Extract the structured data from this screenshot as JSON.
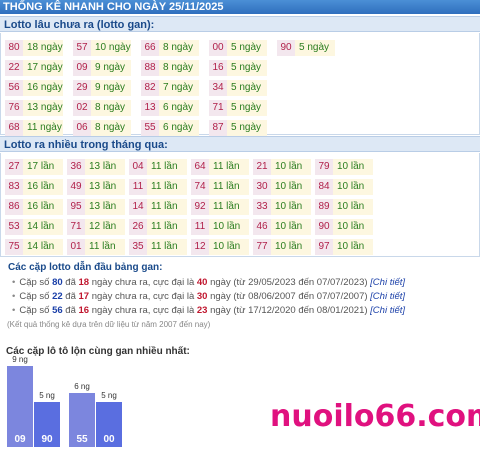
{
  "header": {
    "title": "THỐNG KÊ NHANH CHO NGÀY 25/11/2025"
  },
  "gan": {
    "title": "Lotto lâu chưa ra (lotto gan):",
    "items": [
      {
        "num": "80",
        "val": "18 ngày"
      },
      {
        "num": "57",
        "val": "10 ngày"
      },
      {
        "num": "66",
        "val": "8 ngày"
      },
      {
        "num": "00",
        "val": "5 ngày"
      },
      {
        "num": "90",
        "val": "5 ngày"
      },
      {
        "num": "22",
        "val": "17 ngày"
      },
      {
        "num": "09",
        "val": "9 ngày"
      },
      {
        "num": "88",
        "val": "8 ngày"
      },
      {
        "num": "16",
        "val": "5 ngày"
      },
      {
        "num": "56",
        "val": "16 ngày"
      },
      {
        "num": "29",
        "val": "9 ngày"
      },
      {
        "num": "82",
        "val": "7 ngày"
      },
      {
        "num": "34",
        "val": "5 ngày"
      },
      {
        "num": "76",
        "val": "13 ngày"
      },
      {
        "num": "02",
        "val": "8 ngày"
      },
      {
        "num": "13",
        "val": "6 ngày"
      },
      {
        "num": "71",
        "val": "5 ngày"
      },
      {
        "num": "68",
        "val": "11 ngày"
      },
      {
        "num": "06",
        "val": "8 ngày"
      },
      {
        "num": "55",
        "val": "6 ngày"
      },
      {
        "num": "87",
        "val": "5 ngày"
      }
    ]
  },
  "often": {
    "title": "Lotto ra nhiều trong tháng qua:",
    "items": [
      {
        "num": "27",
        "val": "17 lần"
      },
      {
        "num": "36",
        "val": "13 lần"
      },
      {
        "num": "04",
        "val": "11 lần"
      },
      {
        "num": "64",
        "val": "11 lần"
      },
      {
        "num": "21",
        "val": "10 lần"
      },
      {
        "num": "79",
        "val": "10 lần"
      },
      {
        "num": "83",
        "val": "16 lần"
      },
      {
        "num": "49",
        "val": "13 lần"
      },
      {
        "num": "11",
        "val": "11 lần"
      },
      {
        "num": "74",
        "val": "11 lần"
      },
      {
        "num": "30",
        "val": "10 lần"
      },
      {
        "num": "84",
        "val": "10 lần"
      },
      {
        "num": "86",
        "val": "16 lần"
      },
      {
        "num": "95",
        "val": "13 lần"
      },
      {
        "num": "14",
        "val": "11 lần"
      },
      {
        "num": "92",
        "val": "11 lần"
      },
      {
        "num": "33",
        "val": "10 lần"
      },
      {
        "num": "89",
        "val": "10 lần"
      },
      {
        "num": "53",
        "val": "14 lần"
      },
      {
        "num": "71",
        "val": "12 lần"
      },
      {
        "num": "26",
        "val": "11 lần"
      },
      {
        "num": "11",
        "val": "10 lần"
      },
      {
        "num": "46",
        "val": "10 lần"
      },
      {
        "num": "90",
        "val": "10 lần"
      },
      {
        "num": "75",
        "val": "14 lần"
      },
      {
        "num": "01",
        "val": "11 lần"
      },
      {
        "num": "35",
        "val": "11 lần"
      },
      {
        "num": "12",
        "val": "10 lần"
      },
      {
        "num": "77",
        "val": "10 lần"
      },
      {
        "num": "97",
        "val": "10 lần"
      }
    ]
  },
  "pairs": {
    "title": "Các cặp lotto dẫn đầu bảng gan:",
    "items": [
      {
        "p1": "Cặp số ",
        "num": "80",
        "p2": " đã ",
        "days": "18",
        "p3": " ngày chưa ra, cực đại là ",
        "max": "40",
        "p4": " ngày (từ 29/05/2023 đến 07/07/2023)",
        "link": "[Chi tiết]"
      },
      {
        "p1": "Cặp số ",
        "num": "22",
        "p2": " đã ",
        "days": "17",
        "p3": " ngày chưa ra, cực đại là ",
        "max": "30",
        "p4": " ngày (từ 08/06/2007 đến 07/07/2007)",
        "link": "[Chi tiết]"
      },
      {
        "p1": "Cặp số ",
        "num": "56",
        "p2": " đã ",
        "days": "16",
        "p3": " ngày chưa ra, cực đại là ",
        "max": "23",
        "p4": " ngày (từ 17/12/2020 đến 08/01/2021)",
        "link": "[Chi tiết]"
      }
    ],
    "note": "(Kết quả thống kê dựa trên dữ liệu từ năm 2007 đến nay)"
  },
  "bars": {
    "title": "Các cặp lô tô lộn cùng gan nhiều nhất:",
    "items": [
      {
        "label": "09",
        "top": "9 ng",
        "days": 9
      },
      {
        "label": "90",
        "top": "5 ng",
        "days": 5
      },
      {
        "label": "55",
        "top": "6 ng",
        "days": 6
      },
      {
        "label": "00",
        "top": "5 ng",
        "days": 5
      }
    ]
  },
  "brand": "nuoilo66.com"
}
